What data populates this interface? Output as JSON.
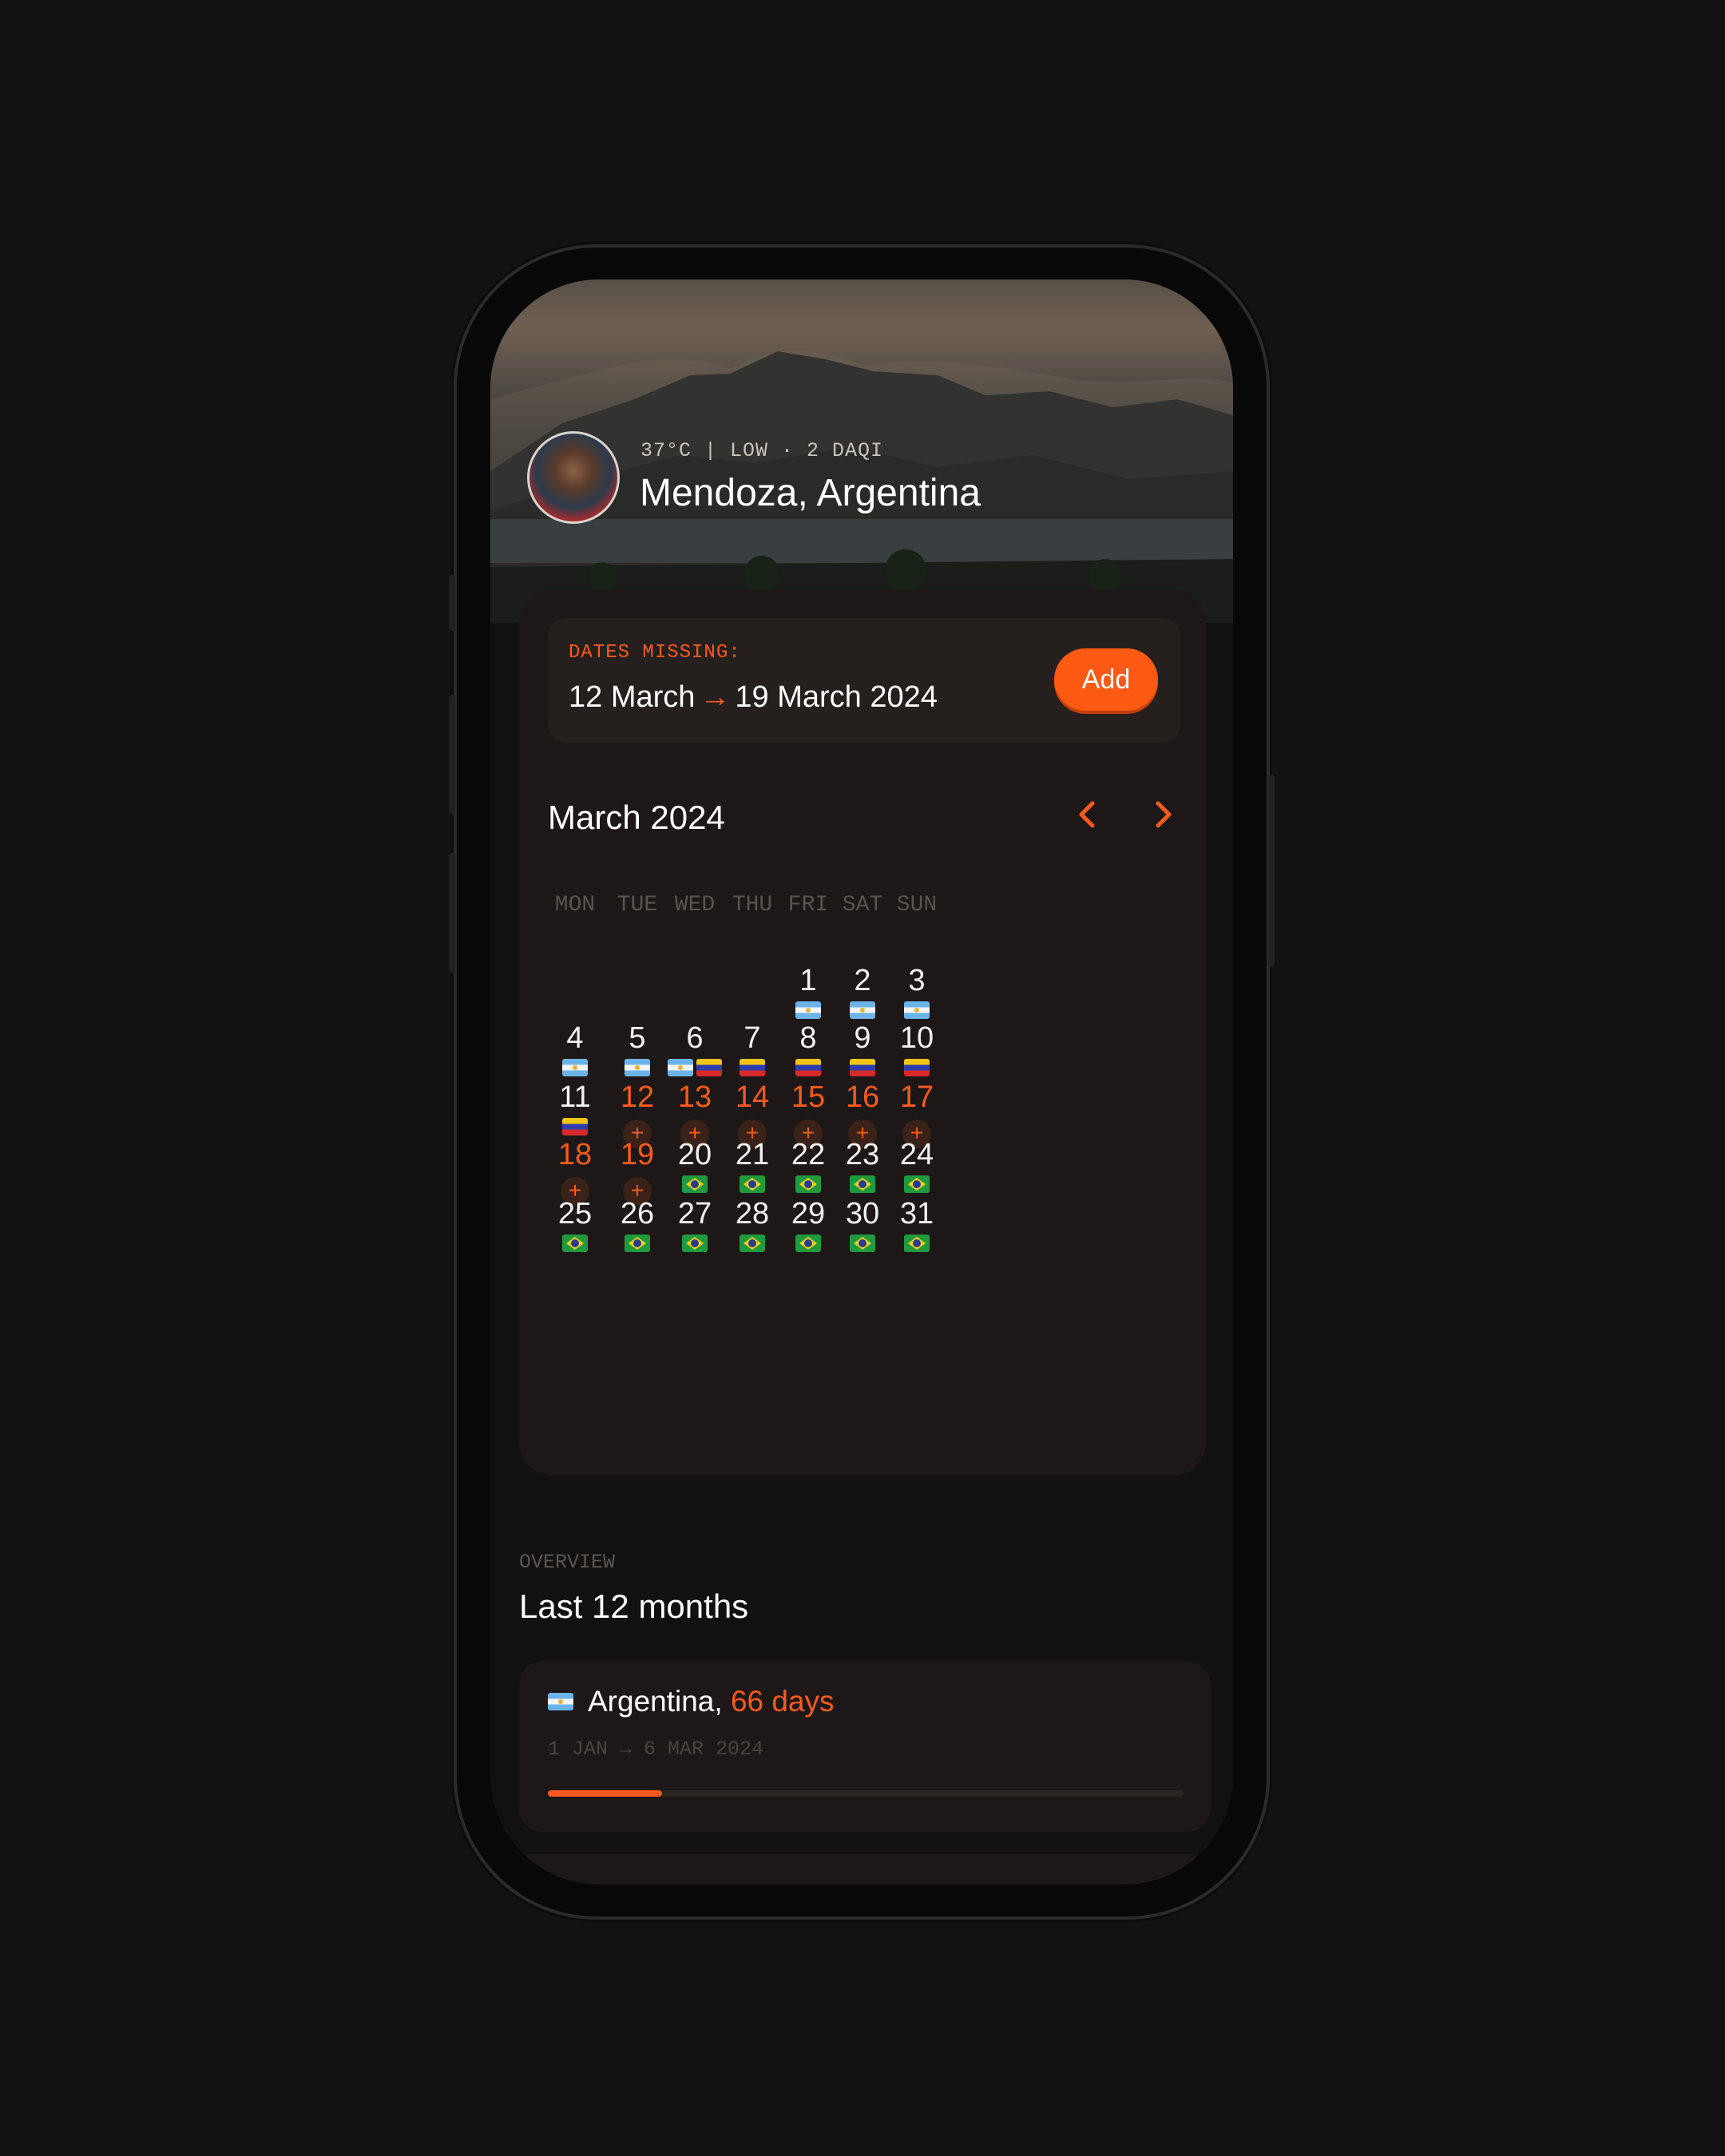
{
  "header": {
    "weather": "37°C | LOW · 2 DAQI",
    "location": "Mendoza, Argentina"
  },
  "missing": {
    "label": "DATES MISSING:",
    "start": "12 March",
    "arrow": "→",
    "end": "19 March 2024",
    "add_label": "Add"
  },
  "calendar": {
    "month": "March 2024",
    "weekdays": [
      "MON",
      "TUE",
      "WED",
      "THU",
      "FRI",
      "SAT",
      "SUN"
    ],
    "weeks": [
      [
        null,
        null,
        null,
        null,
        {
          "d": "1",
          "flags": [
            "ar"
          ]
        },
        {
          "d": "2",
          "flags": [
            "ar"
          ]
        },
        {
          "d": "3",
          "flags": [
            "ar"
          ]
        }
      ],
      [
        {
          "d": "4",
          "flags": [
            "ar"
          ]
        },
        {
          "d": "5",
          "flags": [
            "ar"
          ]
        },
        {
          "d": "6",
          "flags": [
            "ar",
            "ve"
          ]
        },
        {
          "d": "7",
          "flags": [
            "ve"
          ]
        },
        {
          "d": "8",
          "flags": [
            "ve"
          ]
        },
        {
          "d": "9",
          "flags": [
            "ve"
          ]
        },
        {
          "d": "10",
          "flags": [
            "ve"
          ]
        }
      ],
      [
        {
          "d": "11",
          "flags": [
            "ve"
          ]
        },
        {
          "d": "12",
          "missing": true
        },
        {
          "d": "13",
          "missing": true
        },
        {
          "d": "14",
          "missing": true
        },
        {
          "d": "15",
          "missing": true
        },
        {
          "d": "16",
          "missing": true
        },
        {
          "d": "17",
          "missing": true
        }
      ],
      [
        {
          "d": "18",
          "missing": true
        },
        {
          "d": "19",
          "missing": true
        },
        {
          "d": "20",
          "flags": [
            "br"
          ]
        },
        {
          "d": "21",
          "flags": [
            "br"
          ]
        },
        {
          "d": "22",
          "flags": [
            "br"
          ]
        },
        {
          "d": "23",
          "flags": [
            "br"
          ]
        },
        {
          "d": "24",
          "flags": [
            "br"
          ]
        }
      ],
      [
        {
          "d": "25",
          "flags": [
            "br"
          ]
        },
        {
          "d": "26",
          "flags": [
            "br"
          ]
        },
        {
          "d": "27",
          "flags": [
            "br"
          ]
        },
        {
          "d": "28",
          "flags": [
            "br"
          ]
        },
        {
          "d": "29",
          "flags": [
            "br"
          ]
        },
        {
          "d": "30",
          "flags": [
            "br"
          ]
        },
        {
          "d": "31",
          "flags": [
            "br"
          ]
        }
      ]
    ],
    "missing_day_symbol": "+"
  },
  "overview": {
    "label": "OVERVIEW",
    "title": "Last 12 months",
    "countries": [
      {
        "flag": "ar",
        "name": "Argentina,",
        "days": "66 days",
        "dates": "1 JAN → 6 MAR 2024",
        "progress": 0.18
      }
    ]
  },
  "colors": {
    "accent": "#ff5a1f",
    "background": "#111111",
    "card": "#1d1817"
  }
}
